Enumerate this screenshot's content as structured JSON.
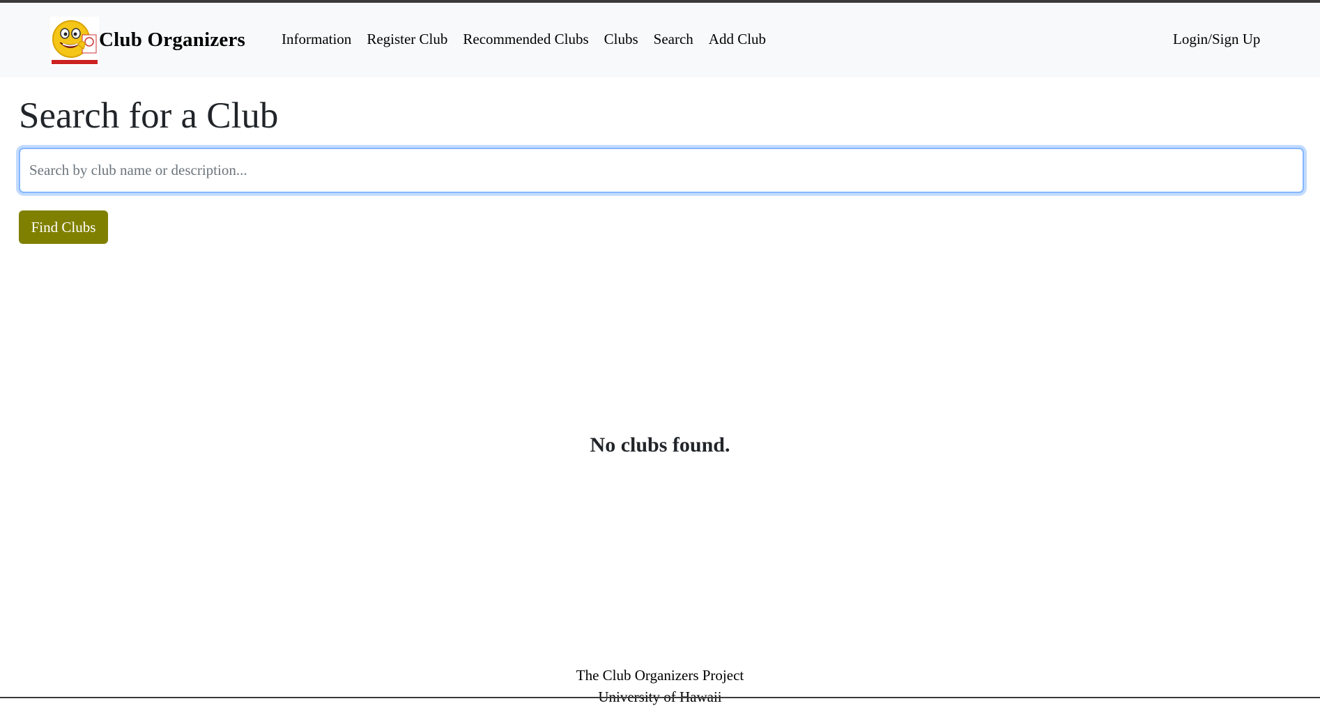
{
  "navbar": {
    "brand_name": "Club Organizers",
    "links": [
      {
        "label": "Information"
      },
      {
        "label": "Register Club"
      },
      {
        "label": "Recommended Clubs"
      },
      {
        "label": "Clubs"
      },
      {
        "label": "Search"
      },
      {
        "label": "Add Club"
      }
    ],
    "login_label": "Login/Sign Up",
    "logo_icon": "smiley-thumbs-up-logo"
  },
  "main": {
    "title": "Search for a Club",
    "search": {
      "placeholder": "Search by club name or description...",
      "value": ""
    },
    "find_button_label": "Find Clubs",
    "empty_message": "No clubs found."
  },
  "footer": {
    "line1": "The Club Organizers Project",
    "line2": "University of Hawaii"
  },
  "colors": {
    "navbar_bg": "#f8f9fa",
    "button_bg": "#808000",
    "focus_border": "#86b7fe"
  }
}
